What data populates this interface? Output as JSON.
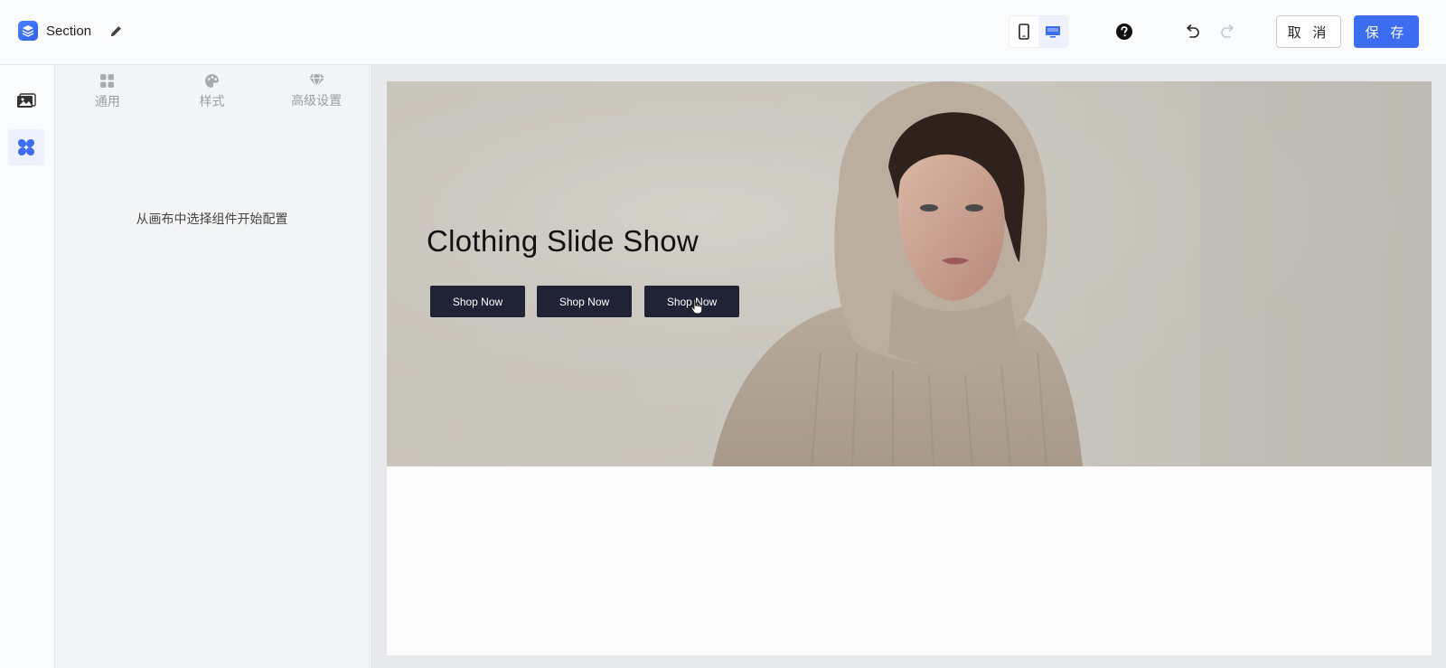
{
  "header": {
    "title": "Section",
    "cancel_label": "取 消",
    "save_label": "保 存",
    "accent_color": "#3c6cf0"
  },
  "device_toggle": {
    "options": [
      "mobile-icon",
      "desktop-icon"
    ],
    "active": "desktop-icon"
  },
  "rail": {
    "items": [
      {
        "icon": "image-gallery-icon",
        "active": false
      },
      {
        "icon": "components-icon",
        "active": true
      }
    ]
  },
  "panel": {
    "tabs": [
      {
        "label": "通用",
        "icon": "grid-icon"
      },
      {
        "label": "样式",
        "icon": "palette-icon"
      },
      {
        "label": "高级设置",
        "icon": "diamond-icon"
      }
    ],
    "empty_message": "从画布中选择组件开始配置"
  },
  "canvas": {
    "hero": {
      "title": "Clothing Slide Show",
      "buttons": [
        "Shop Now",
        "Shop Now",
        "Shop Now"
      ],
      "button_color": "#202335"
    }
  }
}
